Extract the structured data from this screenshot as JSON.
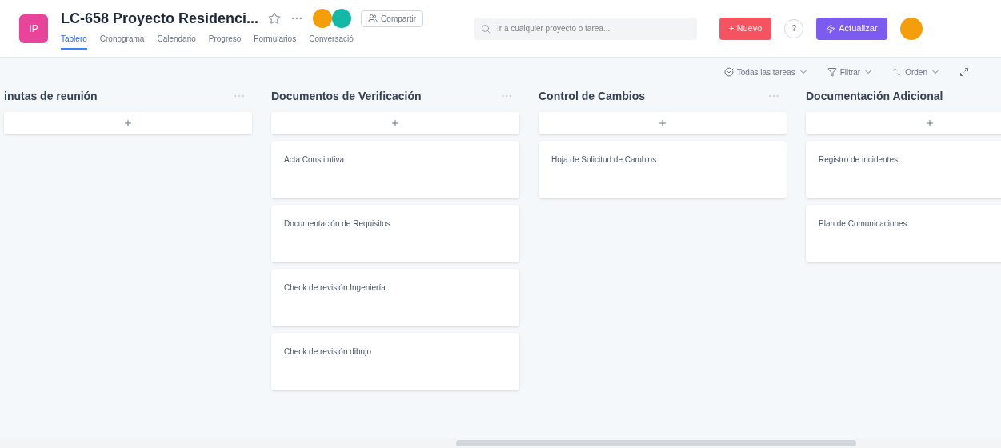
{
  "project": {
    "icon_text": "IP",
    "title": "LC-658 Proyecto Residenci...",
    "share": "Compartir"
  },
  "tabs": [
    {
      "label": "Tablero",
      "selected": true
    },
    {
      "label": "Cronograma",
      "selected": false
    },
    {
      "label": "Calendario",
      "selected": false
    },
    {
      "label": "Progreso",
      "selected": false
    },
    {
      "label": "Formularios",
      "selected": false
    },
    {
      "label": "Conversació",
      "selected": false
    }
  ],
  "search": {
    "placeholder": "Ir a cualquier proyecto o tarea..."
  },
  "new_button": "+ Nuevo",
  "help": "?",
  "upgrade_button": "Actualizar",
  "toolbar": [
    "Todas las tareas",
    "Filtrar",
    "Orden"
  ],
  "columns": [
    {
      "title": "inutas de reunión"
    },
    {
      "title": "Documentos de Verificación",
      "cards": [
        "Acta Constitutiva",
        "Documentación de Requisitos",
        "Check de revisión Ingeniería",
        "Check de revisión dibujo"
      ]
    },
    {
      "title": "Control de Cambios",
      "cards": [
        "Hoja de Solicitud de Cambios"
      ]
    },
    {
      "title": "Documentación Adicional",
      "cards": [
        "Registro de incidentes",
        "Plan de Comunicaciones"
      ]
    }
  ]
}
